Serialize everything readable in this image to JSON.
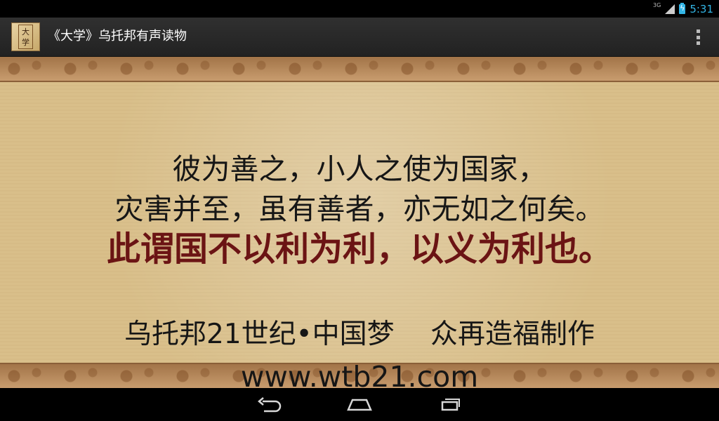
{
  "status": {
    "network": "3G",
    "time": "5:31"
  },
  "action_bar": {
    "title": "《大学》乌托邦有声读物",
    "app_icon_text": "大学",
    "menu_icon": "overflow-menu-icon"
  },
  "content": {
    "line1": "彼为善之，小人之使为国家，",
    "line2": "灾害并至，虽有善者，亦无如之何矣。",
    "line3": "此谓国不以利为利，以义为利也。",
    "line4": "乌托邦21世纪•中国梦　 众再造福制作",
    "line5": "www.wtb21.com"
  },
  "navigation": {
    "back_icon": "back-icon",
    "home_icon": "home-icon",
    "recent_icon": "recent-apps-icon"
  },
  "colors": {
    "accent": "#33b5e5",
    "highlight_text": "#6b1414",
    "paper": "#d9bf8a"
  }
}
